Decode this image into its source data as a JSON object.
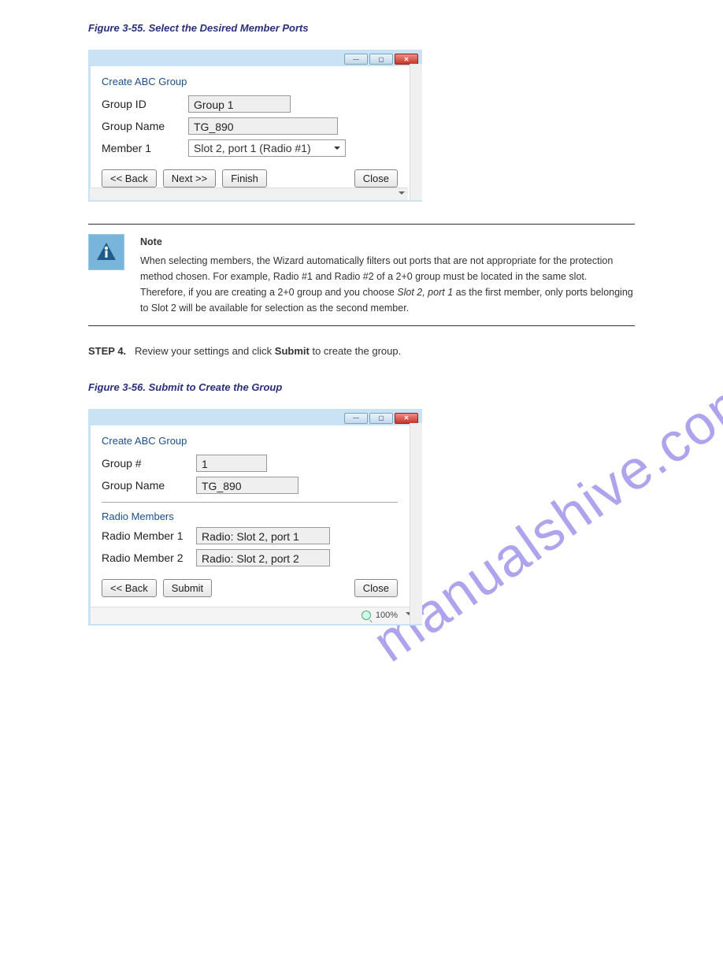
{
  "watermark": "manualshive.com",
  "captions": {
    "figure_55": "Figure 3-55. Select the Desired Member Ports",
    "figure_56": "Figure 3-56. Submit to Create the Group"
  },
  "paragraphs": {
    "intro_to_step4_a": "Review your settings and click ",
    "intro_to_step4_b": " to create the group.",
    "step_4": "STEP 4."
  },
  "note": {
    "title": "Note",
    "body_1": "When selecting members, the Wizard automatically filters out ports that are not appropriate for the protection method chosen. For example, Radio #1 and Radio #2 of a 2+0 group must be located in the same slot. Therefore, if you are creating a 2+0 group and you choose ",
    "body_em": "Slot 2, port 1",
    "body_2": " as the first member, only ports belonging to Slot 2 will be available for selection as the second member."
  },
  "dialog1": {
    "title": "Create ABC Group",
    "fields": {
      "group_id_label": "Group ID",
      "group_id_value": "Group 1",
      "group_name_label": "Group Name",
      "group_name_value": "TG_890",
      "member1_label": "Member 1",
      "member1_value": "Slot 2, port 1 (Radio #1)"
    },
    "buttons": {
      "back": "<< Back",
      "next": "Next >>",
      "finish": "Finish",
      "close": "Close"
    }
  },
  "dialog2": {
    "title": "Create ABC Group",
    "fields": {
      "group_num_label": "Group #",
      "group_num_value": "1",
      "group_name_label": "Group Name",
      "group_name_value": "TG_890",
      "radio_members_heading": "Radio Members",
      "radio_member1_label": "Radio Member 1",
      "radio_member1_value": "Radio: Slot 2, port 1",
      "radio_member2_label": "Radio Member 2",
      "radio_member2_value": "Radio: Slot 2, port 2"
    },
    "buttons": {
      "back": "<< Back",
      "submit": "Submit",
      "close": "Close"
    },
    "status": {
      "zoom": "100%"
    }
  }
}
